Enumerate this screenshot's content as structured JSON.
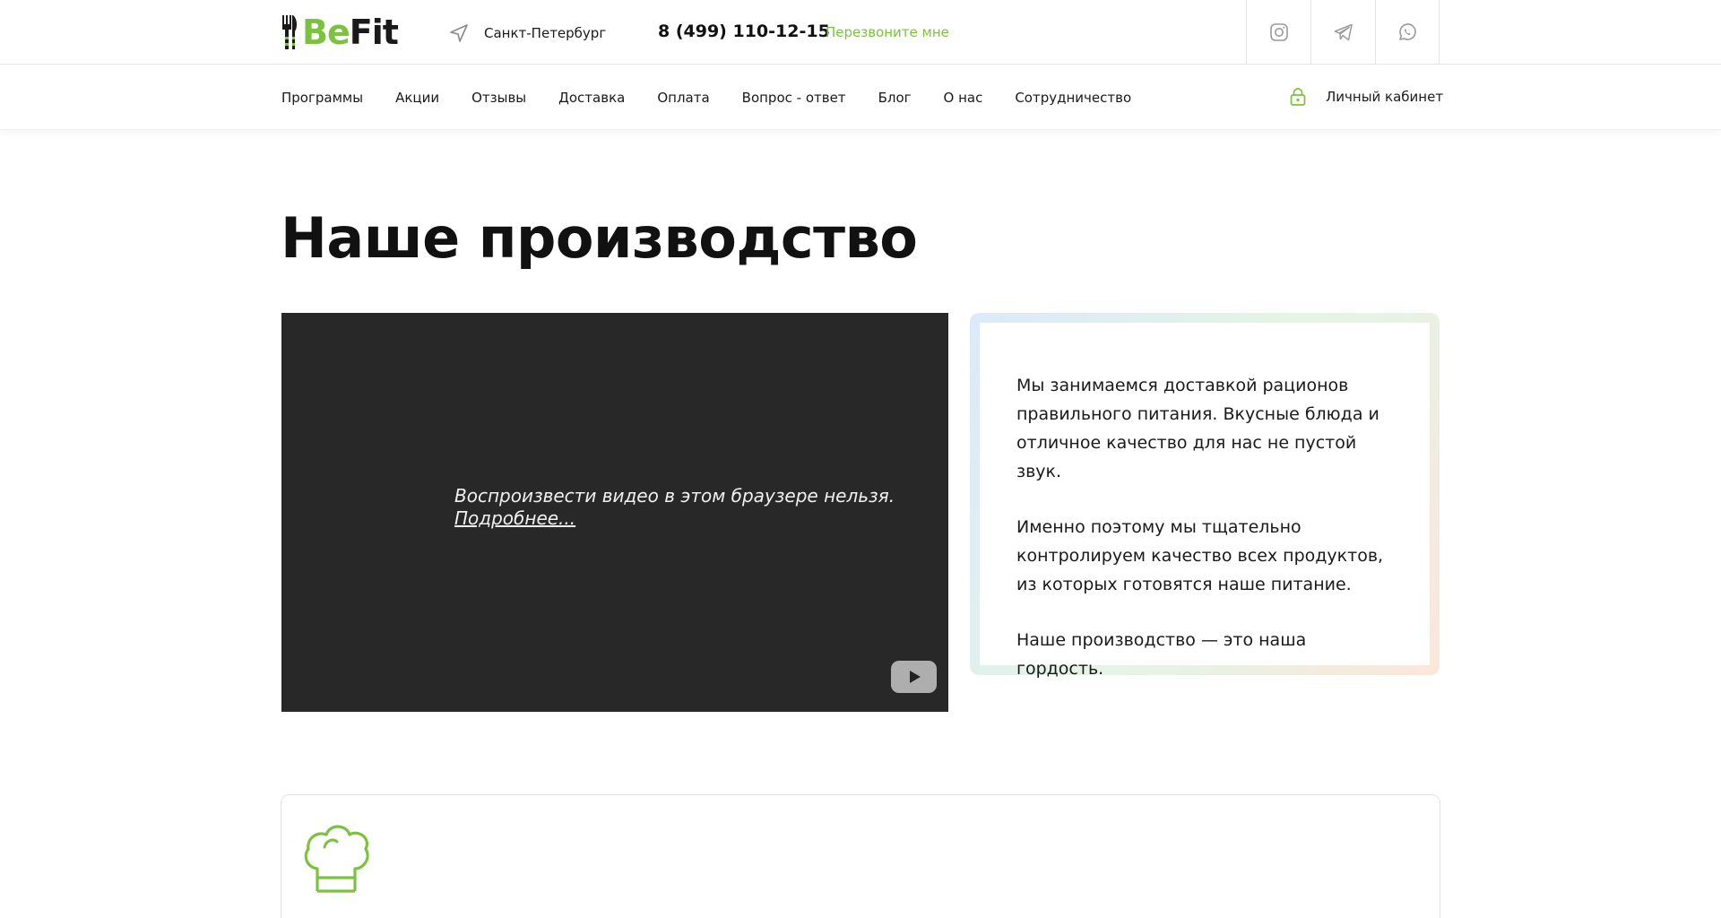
{
  "header": {
    "logo": {
      "part1": "Be",
      "part2": "Fit"
    },
    "city": "Санкт-Петербург",
    "phone": "8 (499) 110-12-15",
    "callback_label": "Перезвоните мне",
    "socials": [
      "instagram-icon",
      "telegram-icon",
      "whatsapp-icon"
    ]
  },
  "nav": {
    "items": [
      "Программы",
      "Акции",
      "Отзывы",
      "Доставка",
      "Оплата",
      "Вопрос - ответ",
      "Блог",
      "О нас",
      "Сотрудничество"
    ],
    "account_label": "Личный кабинет"
  },
  "main": {
    "title": "Наше производство",
    "video": {
      "message": "Воспроизвести видео в этом браузере нельзя.",
      "more_link": "Подробнее..."
    },
    "text_card": {
      "p1": "Мы занимаемся доставкой рационов правильного питания. Вкусные блюда и отличное качество для нас не пустой звук.",
      "p2": "Именно поэтому мы тщательно контролируем качество всех продуктов, из которых готовятся наше питание.",
      "p3": "Наше производство — это наша гордость."
    }
  },
  "colors": {
    "accent": "#7dc23f",
    "text": "#111111",
    "video_bg": "#282828"
  }
}
